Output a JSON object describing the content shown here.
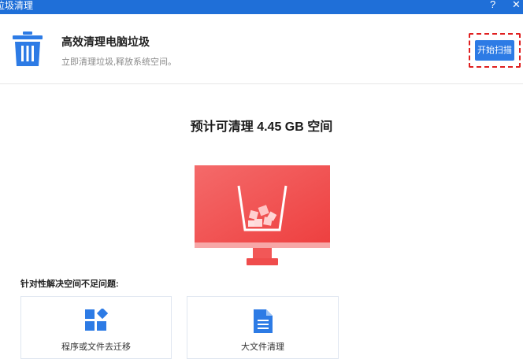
{
  "window": {
    "title": "垃圾清理",
    "help_label": "?",
    "close_label": "✕"
  },
  "header": {
    "icon": "trash-icon",
    "title": "高效清理电脑垃圾",
    "subtitle": "立即清理垃圾,释放系统空间。",
    "scan_button": "开始扫描"
  },
  "main": {
    "estimate": "预计可清理 4.45 GB 空间",
    "illustration": "monitor-trash-illustration",
    "section_label": "针对性解决空间不足问题:",
    "cards": [
      {
        "icon": "apps-grid-icon",
        "label": "程序或文件去迁移"
      },
      {
        "icon": "document-icon",
        "label": "大文件清理"
      }
    ]
  },
  "colors": {
    "titlebar": "#1f6fd8",
    "button": "#2d7be5",
    "highlight": "#e02020",
    "monitor_red": "#f04848",
    "icon_blue": "#2d7be5"
  }
}
